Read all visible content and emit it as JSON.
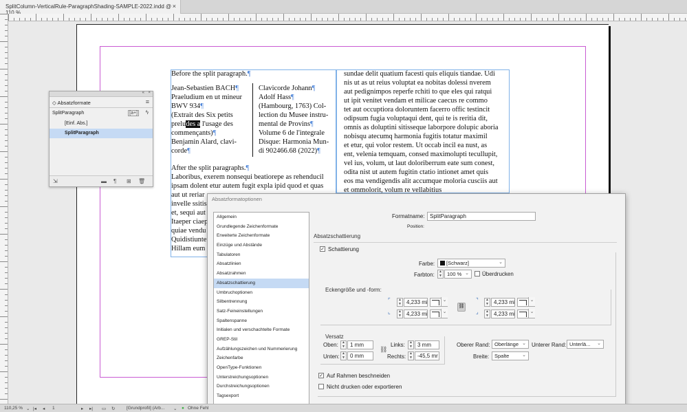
{
  "tab": {
    "title": "SplitColumn-VerticalRule-ParagraphShading-SAMPLE-2022.indd @ 110 %",
    "close": "×"
  },
  "document": {
    "before": "Before the split paragraph.",
    "left_col": [
      "Jean-Sebastien BACH",
      "Praeludium en ut mineur",
      "BWV 934",
      "(Extrait des Six petits",
      "prelu",
      "des a",
      " l'usage des",
      "commençants)",
      "Benjamin Alard, clavi-",
      "corde"
    ],
    "right_col": [
      "Clavicorde Johann",
      "Adolf Hass",
      "(Hambourg, 1763) Col-",
      "lection du Musee instru-",
      "mental de Provins",
      "Volume 6 de l'integrale",
      "Disque: Harmonia Mun-",
      "di 902466.68 (2022)"
    ],
    "after": "After the split paragraphs.",
    "body_lines": [
      "Laboribus, exerem nonsequi beatiorepe as rehenducil",
      "ipsam dolent etur autem fugit expla ipid quod et quas",
      "aut ut reriar",
      "invelle ssitis",
      "et, sequi aut",
      "Itaeper ciaep",
      "quiae vendu",
      "Quidistiunte",
      "Hillam eum"
    ],
    "col2_lines": [
      "sundae delit quatium facesti quis eliquis tiandae. Udi",
      "nis ut as ut reius voluptat ea nobitas dolessi nverem",
      "aut pedignimpos reperfe rchiti to que eles qui ratqui",
      "ut ipit venitet vendam et milicae caecus re commo",
      "tet aut occuptiora doloruntem facerro offic testincit",
      "odipsum fugia voluptaqui dent, qui te is reritia dit,",
      "omnis as doluptini sitisseque laborpore dolupic aboria",
      "nobisqu atecumq harmonia fugitis totatur maximil",
      "et etur, qui volor restem. Ut occab incil ea nust, as",
      "ent, velenia temquam, consed maximolupti tecullupit,",
      "vel ius, volum, ut laut doloriberrum eate sum conest,",
      "odita nist ut autem fugitin ctatio intionet amet quis",
      "eos ma vendigendis alit accumque moloria cusciis aut",
      "et ommolorit, volum re vellabitius"
    ],
    "pilcrow": "¶"
  },
  "panel": {
    "title": "Absatzformate",
    "collapse": "«",
    "close": "×",
    "menu": "≡",
    "current": "SplitParagraph",
    "quick_btn": "[a+]",
    "bolt": "ϟ",
    "styles": [
      "[Einf. Abs.]",
      "SplitParagraph"
    ]
  },
  "dialog": {
    "title": "Absatzformatoptionen",
    "nav": [
      "Allgemein",
      "Grundlegende Zeichenformate",
      "Erweiterte Zeichenformate",
      "Einzüge und Abstände",
      "Tabulatoren",
      "Absatzlinien",
      "Absatzrahmen",
      "Absatzschattierung",
      "Umbruchoptionen",
      "Silbentrennung",
      "Satz-Feineinstellungen",
      "Spaltenspanne",
      "Initialen und verschachtelte Formate",
      "GREP-Stil",
      "Aufzählungszeichen und Nummerierung",
      "Zeichenfarbe",
      "OpenType-Funktionen",
      "Unterstreichungsoptionen",
      "Durchstreichungsoptionen",
      "Tagsexport"
    ],
    "selected_index": 7,
    "formatname_label": "Formatname:",
    "formatname_value": "SplitParagraph",
    "position_label": "Position:",
    "section_title": "Absatzschattierung",
    "shading_label": "Schattierung",
    "shading_checked": true,
    "color_label": "Farbe:",
    "color_value": "[Schwarz]",
    "tint_label": "Farbton:",
    "tint_value": "100 %",
    "overprint_label": "Überdrucken",
    "corner_section": "Eckengröße und -form:",
    "corner_values": [
      "4,233 mi",
      "4,233 mi",
      "4,233 mi",
      "4,233 mi"
    ],
    "offsets_section": "Versatz",
    "oben_label": "Oben:",
    "oben_value": "1 mm",
    "unten_label": "Unten:",
    "unten_value": "0 mm",
    "links_label": "Links:",
    "links_value": "3 mm",
    "rechts_label": "Rechts:",
    "rechts_value": "-45,5 mr",
    "top_edge_label": "Oberer Rand:",
    "top_edge_value": "Oberlänge",
    "bottom_edge_label": "Unterer Rand:",
    "bottom_edge_value": "Unterlä...",
    "width_label": "Breite:",
    "width_value": "Spalte",
    "clip_label": "Auf Rahmen beschneiden",
    "clip_checked": true,
    "noprint_label": "Nicht drucken oder exportieren",
    "noprint_checked": false
  },
  "statusbar": {
    "zoom": "110,25 %",
    "page": "1",
    "profile": "[Grundprofil] (Arb...",
    "errors": "Ohne Fehl"
  },
  "colors": {
    "accent": "#4f86d9",
    "guide": "#c95bd3",
    "selection": "#c5daf4",
    "ok": "#3cb043"
  }
}
